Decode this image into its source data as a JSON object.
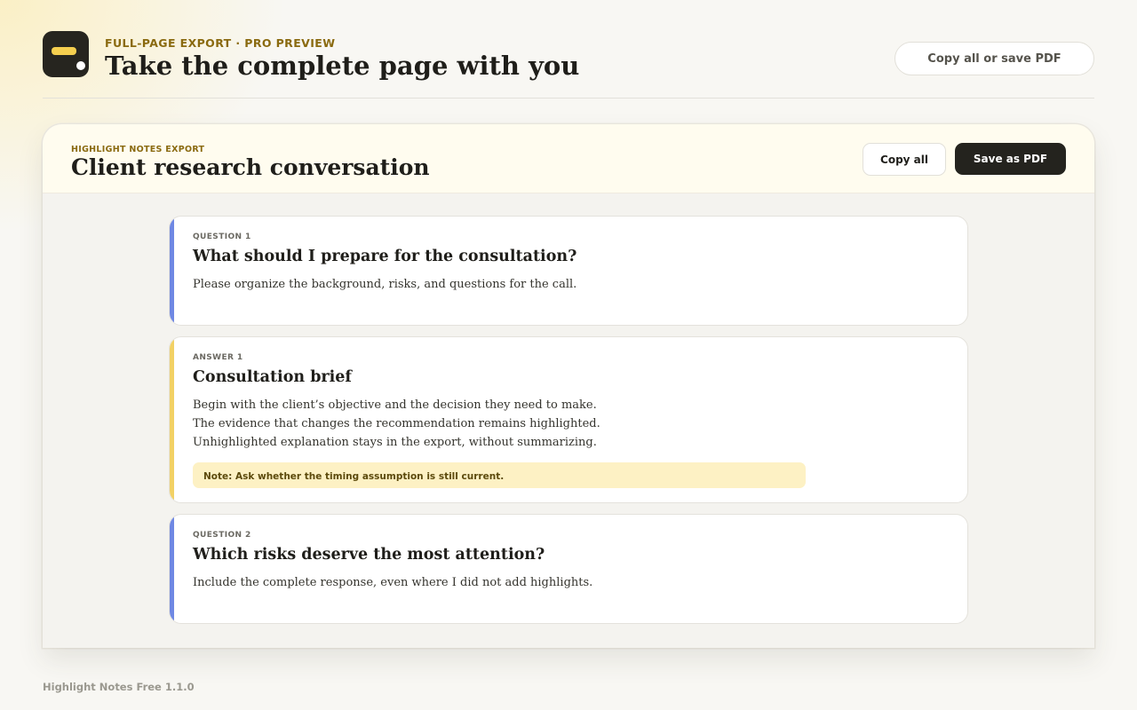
{
  "header": {
    "eyebrow": "FULL-PAGE EXPORT · PRO PREVIEW",
    "title": "Take the complete page with you",
    "action_label": "Copy all or save PDF"
  },
  "preview": {
    "eyebrow": "HIGHLIGHT NOTES EXPORT",
    "title": "Client research conversation",
    "copy_label": "Copy all",
    "pdf_label": "Save as PDF",
    "messages": [
      {
        "kind": "QUESTION 1",
        "title": "What should I prepare for the consultation?",
        "lines": [
          "Please organize the background, risks, and questions for the call."
        ]
      },
      {
        "kind": "ANSWER 1",
        "title": "Consultation brief",
        "lines": [
          "Begin with the client’s objective and the decision they need to make.",
          "The evidence that changes the recommendation remains highlighted.",
          "Unhighlighted explanation stays in the export, without summarizing."
        ],
        "note": "Note: Ask whether the timing assumption is still current."
      },
      {
        "kind": "QUESTION 2",
        "title": "Which risks deserve the most attention?",
        "lines": [
          "Include the complete response, even where I did not add highlights."
        ]
      }
    ]
  },
  "footer": {
    "version": "Highlight Notes Free 1.1.0"
  },
  "colors": {
    "accent_gold": "#8a6a10",
    "question_accent": "#6f88e3",
    "answer_accent": "#f2d165",
    "note_bg": "#fdf1c4",
    "dark_button": "#24231e"
  }
}
